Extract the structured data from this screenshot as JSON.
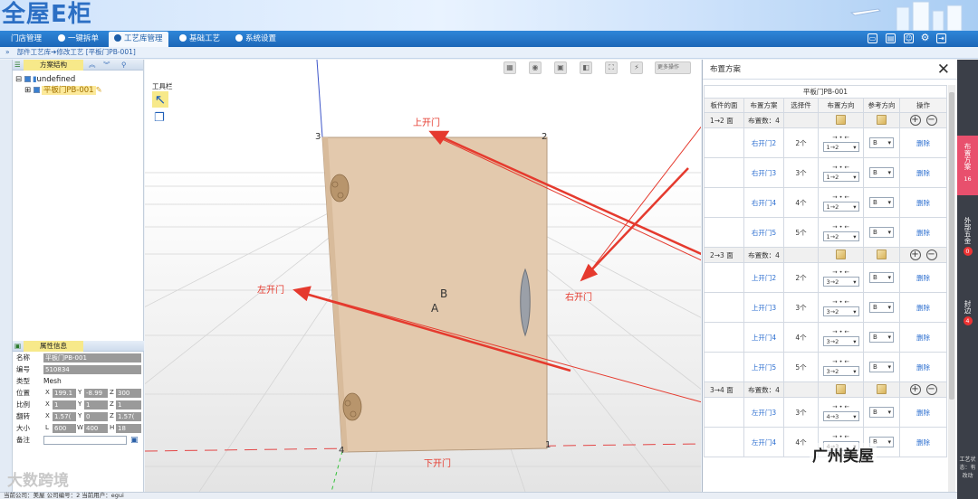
{
  "app": {
    "logo": "全屋E柜"
  },
  "nav": {
    "tabs": [
      "门店管理",
      "一键拆单",
      "工艺库管理",
      "基础工艺",
      "系统设置"
    ],
    "active_index": 2
  },
  "breadcrumb": "部件工艺库➔修改工艺 [平板门PB-001]",
  "left": {
    "tree_header": "方案结构",
    "tree": [
      {
        "label": "undefined",
        "checked": true
      },
      {
        "label": "平板门PB-001",
        "checked": true
      }
    ],
    "props_header": "属性信息",
    "props": {
      "name_label": "名称",
      "name": "平板门PB-001",
      "code_label": "编号",
      "code": "510834",
      "type_label": "类型",
      "type": "Mesh",
      "pos_label": "位置",
      "pos_x": "199.1",
      "pos_y": "-8.99",
      "pos_z": "300",
      "scale_label": "比例",
      "scale_x": "1",
      "scale_y": "1",
      "scale_z": "1",
      "rot_label": "翻转",
      "rot_x": "1.57(",
      "rot_y": "0",
      "rot_z": "1.57(",
      "size_label": "大小",
      "size_l": "600",
      "size_w": "400",
      "size_h": "18",
      "note_label": "备注",
      "note": ""
    }
  },
  "viewport": {
    "toolbox_label": "工具栏",
    "view_select": "更多操作",
    "vertices": [
      "3",
      "2",
      "4",
      "1"
    ],
    "face_labels": [
      "B",
      "A"
    ],
    "annotations": {
      "top": "上开门",
      "left": "左开门",
      "right": "右开门",
      "bottom": "下开门"
    }
  },
  "right": {
    "title": "布置方案",
    "table_caption": "平板门PB-001",
    "headers": [
      "板件的面",
      "布置方案",
      "选择件",
      "布置方向",
      "参考方向",
      "操作"
    ],
    "groups": [
      {
        "face": "1→2 面",
        "count": "布置数：4",
        "items": [
          {
            "name": "右开门2",
            "qty": "2个",
            "dir": "1→2"
          },
          {
            "name": "右开门3",
            "qty": "3个",
            "dir": "1→2"
          },
          {
            "name": "右开门4",
            "qty": "4个",
            "dir": "1→2"
          },
          {
            "name": "右开门5",
            "qty": "5个",
            "dir": "1→2"
          }
        ]
      },
      {
        "face": "2→3 面",
        "count": "布置数：4",
        "items": [
          {
            "name": "上开门2",
            "qty": "2个",
            "dir": "3→2"
          },
          {
            "name": "上开门3",
            "qty": "3个",
            "dir": "3→2"
          },
          {
            "name": "上开门4",
            "qty": "4个",
            "dir": "3→2"
          },
          {
            "name": "上开门5",
            "qty": "5个",
            "dir": "3→2"
          }
        ]
      },
      {
        "face": "3→4 面",
        "count": "布置数：4",
        "items": [
          {
            "name": "左开门3",
            "qty": "3个",
            "dir": "4→3"
          },
          {
            "name": "左开门4",
            "qty": "4个",
            "dir": "4→3"
          }
        ]
      }
    ],
    "ref_value": "B",
    "dir_arrows": "→ • ←",
    "delete_label": "删除"
  },
  "dock": [
    {
      "label": "布置方案",
      "count": "16"
    },
    {
      "label": "外部五金",
      "count": "0"
    },
    {
      "label": "封边",
      "count": "4"
    }
  ],
  "dock_footer": "工艺状态：有改动",
  "status": "当前公司：美屋   公司编号：2   当前用户：egui",
  "watermarks": {
    "left": "大数跨境",
    "right": "广州美屋"
  },
  "colors": {
    "nav": "#1d67b8",
    "annotation": "#e53a2e",
    "door": "#e3c9ad",
    "dock_active": "#e8506d"
  }
}
